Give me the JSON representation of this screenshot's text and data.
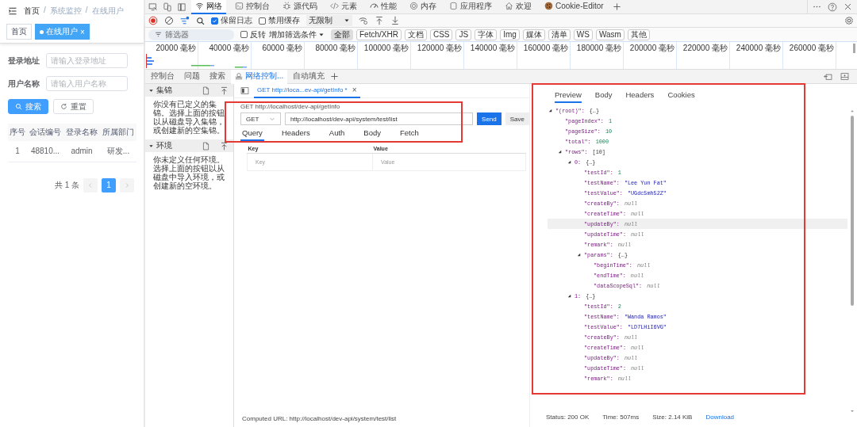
{
  "app": {
    "breadcrumb": {
      "items": [
        "首页",
        "系统监控",
        "在线用户"
      ],
      "separator": "/"
    },
    "tabs": [
      {
        "label": "首页",
        "selected": false
      },
      {
        "label": "在线用户",
        "selected": true,
        "close": "×"
      }
    ],
    "fields": [
      {
        "label": "登录地址",
        "placeholder": "请输入登录地址"
      },
      {
        "label": "用户名称",
        "placeholder": "请输入用户名称"
      }
    ],
    "buttons": [
      {
        "label": "搜索",
        "kind": "primary"
      },
      {
        "label": "重置",
        "kind": "default"
      }
    ],
    "table": {
      "columns": [
        "序号",
        "会话编号",
        "登录名称",
        "所属部门"
      ],
      "rows": [
        [
          "1",
          "48810...",
          "admin",
          "研发..."
        ]
      ]
    },
    "pagination": {
      "total": "共 1 条",
      "pages": [
        {
          "label": "1",
          "selected": true
        }
      ]
    }
  },
  "devtools": {
    "tabs": [
      {
        "label": "网络",
        "selected": true
      },
      {
        "label": "控制台",
        "selected": false
      },
      {
        "label": "源代码",
        "selected": false
      },
      {
        "label": "元素",
        "selected": false
      },
      {
        "label": "性能",
        "selected": false
      },
      {
        "label": "内存",
        "selected": false
      },
      {
        "label": "应用程序",
        "selected": false
      },
      {
        "label": "欢迎",
        "selected": false
      },
      {
        "label": "Cookie-Editor",
        "selected": false
      }
    ],
    "toolbar": {
      "checkboxes": [
        {
          "label": "保留日志",
          "checked": true
        },
        {
          "label": "禁用缓存",
          "checked": false
        }
      ],
      "throttling": "无限制"
    },
    "filter": {
      "placeholder": "筛选器",
      "invert": {
        "label": "反转",
        "checked": false
      },
      "more_filters": "增加筛选条件",
      "types": [
        {
          "label": "全部",
          "selected": true
        },
        {
          "label": "Fetch/XHR",
          "selected": false
        },
        {
          "label": "文档",
          "selected": false
        },
        {
          "label": "CSS",
          "selected": false
        },
        {
          "label": "JS",
          "selected": false
        },
        {
          "label": "字体",
          "selected": false
        },
        {
          "label": "Img",
          "selected": false
        },
        {
          "label": "媒体",
          "selected": false
        },
        {
          "label": "清单",
          "selected": false
        },
        {
          "label": "WS",
          "selected": false
        },
        {
          "label": "Wasm",
          "selected": false
        },
        {
          "label": "其他",
          "selected": false
        }
      ]
    },
    "overview": {
      "ticks": [
        "20000 毫秒",
        "40000 毫秒",
        "60000 毫秒",
        "80000 毫秒",
        "100000 毫秒",
        "120000 毫秒",
        "140000 毫秒",
        "160000 毫秒",
        "180000 毫秒",
        "200000 毫秒",
        "220000 毫秒",
        "240000 毫秒",
        "260000 毫秒"
      ]
    },
    "drawer_tabs": [
      {
        "label": "控制台",
        "selected": false
      },
      {
        "label": "问题",
        "selected": false
      },
      {
        "label": "搜索",
        "selected": false
      },
      {
        "label": "网络控制...",
        "selected": true
      },
      {
        "label": "自动填充",
        "selected": false
      }
    ]
  },
  "collections": {
    "sections": [
      {
        "title": "集锦",
        "expanded": true,
        "text": "你没有已定义的集锦。选择上面的按钮以从磁盘导入集锦，或创建新的空集锦。"
      },
      {
        "title": "环境",
        "expanded": true,
        "text": "你未定义任何环境。选择上面的按钮以从磁盘中导入环境，或创建新的空环境。"
      }
    ]
  },
  "request": {
    "tab": {
      "label": "GET http://loca...ev-api/getInfo *",
      "close": "×"
    },
    "heading": "GET http://localhost/dev-api/getInfo",
    "method": "GET",
    "url": "http://localhost/dev-api/system/test/list",
    "highlighted": true,
    "buttons": [
      {
        "label": "Send",
        "kind": "primary"
      },
      {
        "label": "Save",
        "kind": "default"
      }
    ],
    "tabs": [
      {
        "label": "Query",
        "selected": true
      },
      {
        "label": "Headers",
        "selected": false
      },
      {
        "label": "Auth",
        "selected": false
      },
      {
        "label": "Body",
        "selected": false
      },
      {
        "label": "Fetch",
        "selected": false
      }
    ],
    "params": {
      "columns": [
        "Key",
        "Value"
      ],
      "placeholders": [
        "Key",
        "Value"
      ]
    },
    "computed_url": "Computed URL: http://localhost/dev-api/system/test/list"
  },
  "response": {
    "highlighted": true,
    "tabs": [
      {
        "label": "Preview",
        "selected": true
      },
      {
        "label": "Body",
        "selected": false
      },
      {
        "label": "Headers",
        "selected": false
      },
      {
        "label": "Cookies",
        "selected": false
      }
    ],
    "tree": [
      {
        "key": "\"(root)\":",
        "value": "{…}",
        "kind": "object",
        "expanded": true,
        "hover": false,
        "children": [
          {
            "key": "\"pageIndex\":",
            "value": "1",
            "kind": "number",
            "hover": false
          },
          {
            "key": "\"pageSize\":",
            "value": "10",
            "kind": "number",
            "hover": false
          },
          {
            "key": "\"total\":",
            "value": "1000",
            "kind": "number",
            "hover": false
          },
          {
            "key": "\"rows\":",
            "value": "[10]",
            "kind": "object",
            "expanded": true,
            "hover": false,
            "children": [
              {
                "key": "0:",
                "value": "{…}",
                "kind": "object",
                "expanded": true,
                "hover": false,
                "children": [
                  {
                    "key": "\"testId\":",
                    "value": "1",
                    "kind": "number",
                    "hover": false
                  },
                  {
                    "key": "\"testName\":",
                    "value": "\"Lee Yun Fat\"",
                    "kind": "string",
                    "hover": false
                  },
                  {
                    "key": "\"testValue\":",
                    "value": "\"UGdc5mh52Z\"",
                    "kind": "string",
                    "hover": false
                  },
                  {
                    "key": "\"createBy\":",
                    "value": "null",
                    "kind": "null",
                    "hover": false
                  },
                  {
                    "key": "\"createTime\":",
                    "value": "null",
                    "kind": "null",
                    "hover": false
                  },
                  {
                    "key": "\"updateBy\":",
                    "value": "null",
                    "kind": "null",
                    "hover": true
                  },
                  {
                    "key": "\"updateTime\":",
                    "value": "null",
                    "kind": "null",
                    "hover": false
                  },
                  {
                    "key": "\"remark\":",
                    "value": "null",
                    "kind": "null",
                    "hover": false
                  },
                  {
                    "key": "\"params\":",
                    "value": "{…}",
                    "kind": "object",
                    "expanded": true,
                    "hover": false,
                    "children": [
                      {
                        "key": "\"beginTime\":",
                        "value": "null",
                        "kind": "null",
                        "hover": false
                      },
                      {
                        "key": "\"endTime\":",
                        "value": "null",
                        "kind": "null",
                        "hover": false
                      },
                      {
                        "key": "\"dataScopeSql\":",
                        "value": "null",
                        "kind": "null",
                        "hover": false
                      }
                    ]
                  }
                ]
              },
              {
                "key": "1:",
                "value": "{…}",
                "kind": "object",
                "expanded": true,
                "hover": false,
                "children": [
                  {
                    "key": "\"testId\":",
                    "value": "2",
                    "kind": "number",
                    "hover": false
                  },
                  {
                    "key": "\"testName\":",
                    "value": "\"Wanda Ramos\"",
                    "kind": "string",
                    "hover": false
                  },
                  {
                    "key": "\"testValue\":",
                    "value": "\"LD7LHiI6VG\"",
                    "kind": "string",
                    "hover": false
                  },
                  {
                    "key": "\"createBy\":",
                    "value": "null",
                    "kind": "null",
                    "hover": false
                  },
                  {
                    "key": "\"createTime\":",
                    "value": "null",
                    "kind": "null",
                    "hover": false
                  },
                  {
                    "key": "\"updateBy\":",
                    "value": "null",
                    "kind": "null",
                    "hover": false
                  },
                  {
                    "key": "\"updateTime\":",
                    "value": "null",
                    "kind": "null",
                    "hover": false
                  },
                  {
                    "key": "\"remark\":",
                    "value": "null",
                    "kind": "null",
                    "hover": false
                  }
                ]
              }
            ]
          }
        ]
      }
    ],
    "status": [
      "Status: 200 OK",
      "Time: 507ms",
      "Size: 2.14 KiB"
    ],
    "download": "Download"
  }
}
